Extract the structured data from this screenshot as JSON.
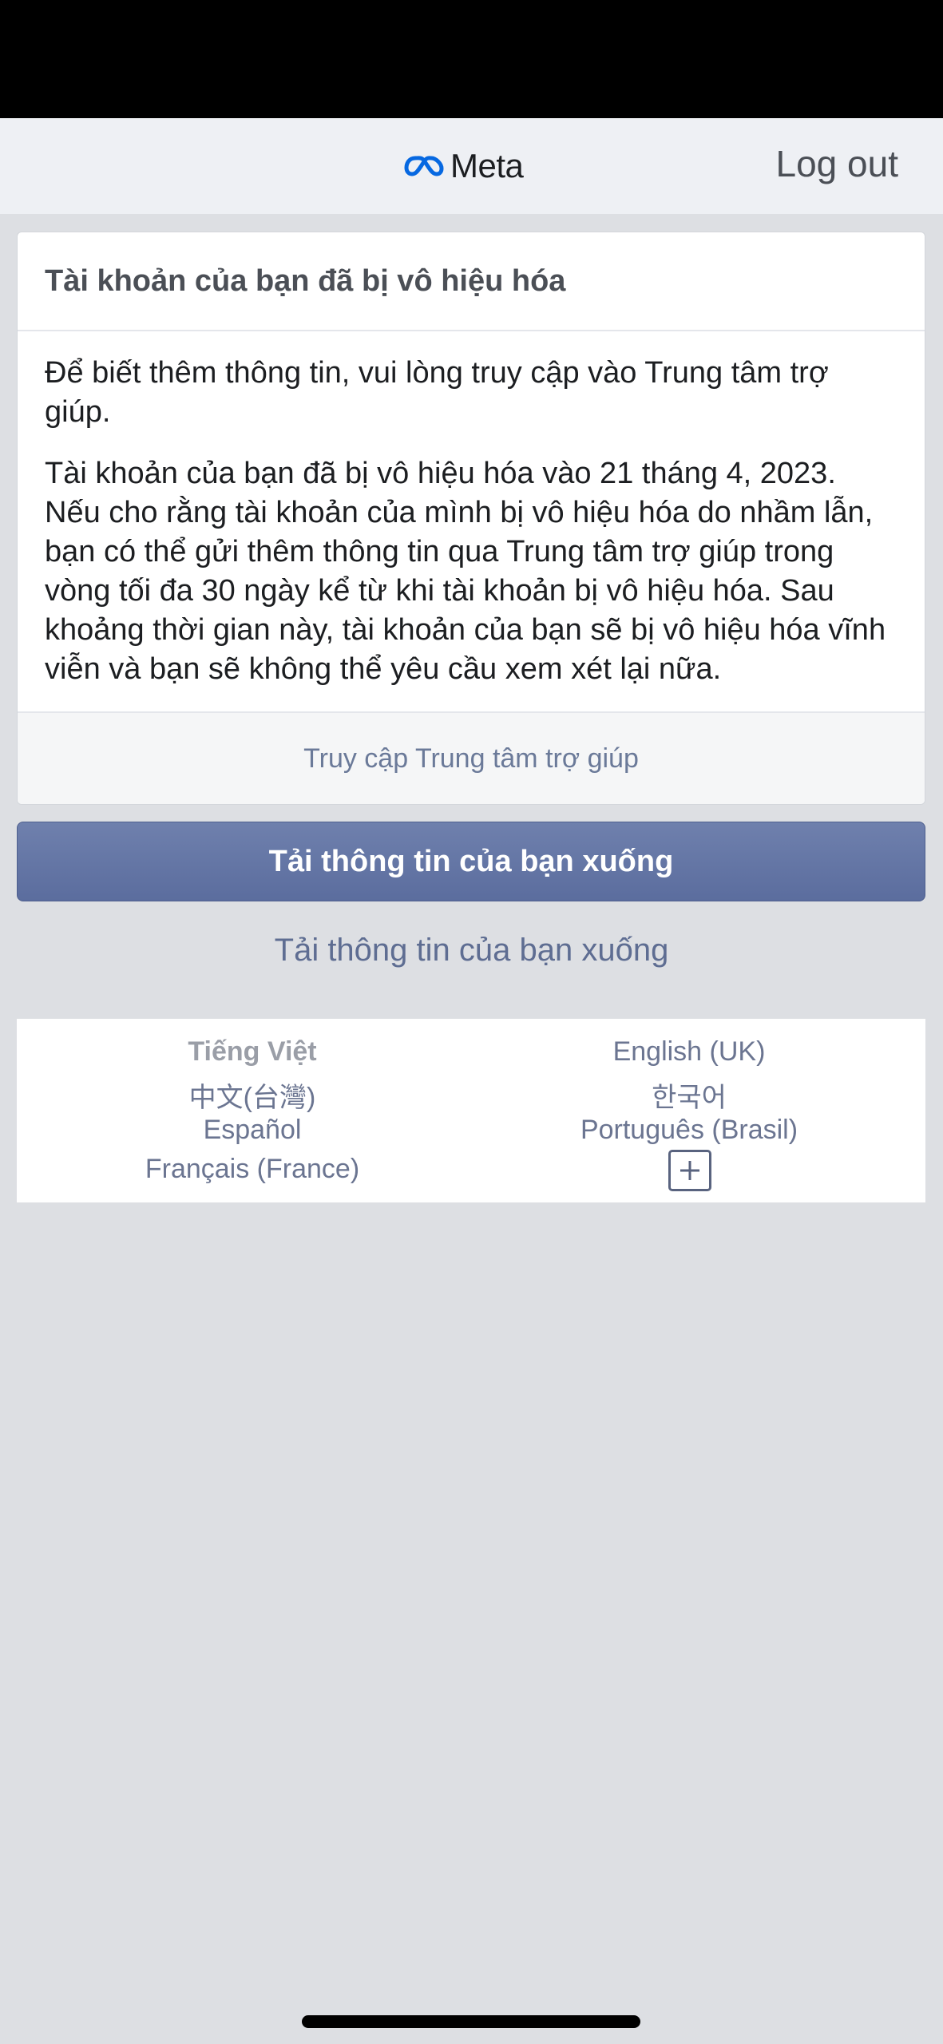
{
  "header": {
    "logo_text": "Meta",
    "logout_label": "Log out"
  },
  "card": {
    "title": "Tài khoản của bạn đã bị vô hiệu hóa",
    "paragraph1": "Để biết thêm thông tin, vui lòng truy cập vào Trung tâm trợ giúp.",
    "paragraph2": "Tài khoản của bạn đã bị vô hiệu hóa vào 21 tháng 4, 2023. Nếu cho rằng tài khoản của mình bị vô hiệu hóa do nhầm lẫn, bạn có thể gửi thêm thông tin qua Trung tâm trợ giúp trong vòng tối đa 30 ngày kể từ khi tài khoản bị vô hiệu hóa. Sau khoảng thời gian này, tài khoản của bạn sẽ bị vô hiệu hóa vĩnh viễn và bạn sẽ không thể yêu cầu xem xét lại nữa.",
    "help_link": "Truy cập Trung tâm trợ giúp"
  },
  "download_button_label": "Tải thông tin của bạn xuống",
  "download_link_label": "Tải thông tin của bạn xuống",
  "languages": {
    "current": "Tiếng Việt",
    "items": [
      "English (UK)",
      "中文(台灣)",
      "한국어",
      "Español",
      "Português (Brasil)",
      "Français (France)"
    ],
    "more_icon": "plus-icon"
  },
  "colors": {
    "status_bar": "#000000",
    "header_bg": "#eef0f4",
    "page_bg": "#dddfe3",
    "primary_button": "#6577a6",
    "link": "#6b7a99",
    "meta_logo": "#0668e1"
  }
}
